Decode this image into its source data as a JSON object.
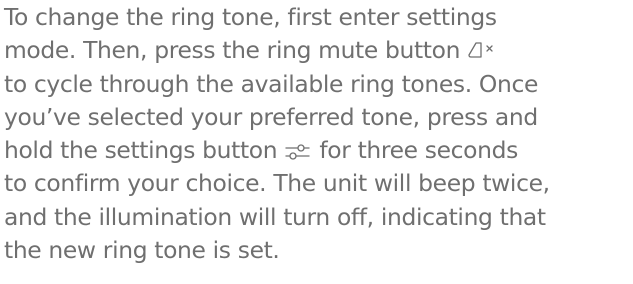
{
  "text": {
    "line1": "To change the ring tone, first enter settings",
    "line2_before_icon": "mode. Then, press the ring mute button ",
    "line3": "to cycle through the available ring tones. Once",
    "line4": "you’ve selected your preferred tone, press and",
    "line5_before_icon": "hold the settings button ",
    "line5_after_icon": " for three seconds",
    "line6": "to confirm your choice. The unit will beep twice,",
    "line7": "and the illumination will turn off, indicating that",
    "line8": "the new ring tone is set."
  },
  "icons": {
    "ring_mute": "speaker-mute-icon",
    "settings": "settings-slider-icon"
  },
  "colors": {
    "text": "#6f6f6f"
  }
}
